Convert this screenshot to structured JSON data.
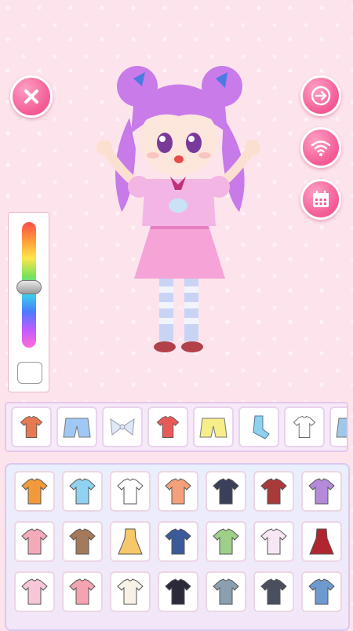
{
  "buttons": {
    "close": {
      "icon": "close-icon"
    },
    "next": {
      "icon": "arrow-right-icon"
    },
    "wifi": {
      "icon": "wifi-icon"
    },
    "calendar": {
      "icon": "calendar-icon"
    }
  },
  "colors": {
    "button_pink": "#f35a95",
    "background": "#fde4ec",
    "panel_border": "#d9c8ee"
  },
  "color_slider": {
    "level": 0.52
  },
  "categories": [
    {
      "icon": "tshirt-orange-icon",
      "color": "#e57a52"
    },
    {
      "icon": "shorts-blue-icon",
      "color": "#9fc8f5"
    },
    {
      "icon": "bow-icon",
      "color": "#dfe8f5"
    },
    {
      "icon": "crop-top-red-icon",
      "color": "#e85a5a"
    },
    {
      "icon": "shorts-yellow-icon",
      "color": "#f7ee8a"
    },
    {
      "icon": "sock-icon",
      "color": "#8fd1ef"
    },
    {
      "icon": "tshirt-white-icon",
      "color": "#ffffff"
    },
    {
      "icon": "shoe-blue-icon",
      "color": "#9ec7ea"
    }
  ],
  "items": [
    {
      "icon": "orange-hoodie-icon",
      "color": "#f29a3b"
    },
    {
      "icon": "anchor-shirt-icon",
      "color": "#8fd3f0"
    },
    {
      "icon": "raglan-shirt-icon",
      "color": "#ffffff"
    },
    {
      "icon": "heart-tee-icon",
      "color": "#f4a07a"
    },
    {
      "icon": "navy-vest-icon",
      "color": "#3a3f5a"
    },
    {
      "icon": "red-jacket-icon",
      "color": "#a83a3a"
    },
    {
      "icon": "purple-cardigan-icon",
      "color": "#b48ad9"
    },
    {
      "icon": "pink-hoodie-icon",
      "color": "#f4aab9"
    },
    {
      "icon": "brown-sweater-icon",
      "color": "#a47a5a"
    },
    {
      "icon": "yellow-dress-icon",
      "color": "#f7c86a"
    },
    {
      "icon": "denim-jacket-icon",
      "color": "#3a5a9a"
    },
    {
      "icon": "green-jacket-icon",
      "color": "#9ed08a"
    },
    {
      "icon": "pastel-coat-icon",
      "color": "#f7e7f5"
    },
    {
      "icon": "red-dress-icon",
      "color": "#b0252e"
    },
    {
      "icon": "bunny-sweater-icon",
      "color": "#f7c6d9"
    },
    {
      "icon": "heart-sweater-icon",
      "color": "#f4a4b0"
    },
    {
      "icon": "sailor-top-icon",
      "color": "#f7f1e6"
    },
    {
      "icon": "heart-jersey-icon",
      "color": "#2a2a3a"
    },
    {
      "icon": "club-shirt-icon",
      "color": "#8aa0b0"
    },
    {
      "icon": "blazer-icon",
      "color": "#4a4f60"
    },
    {
      "icon": "jean-jacket-icon",
      "color": "#6f9ad0"
    }
  ]
}
